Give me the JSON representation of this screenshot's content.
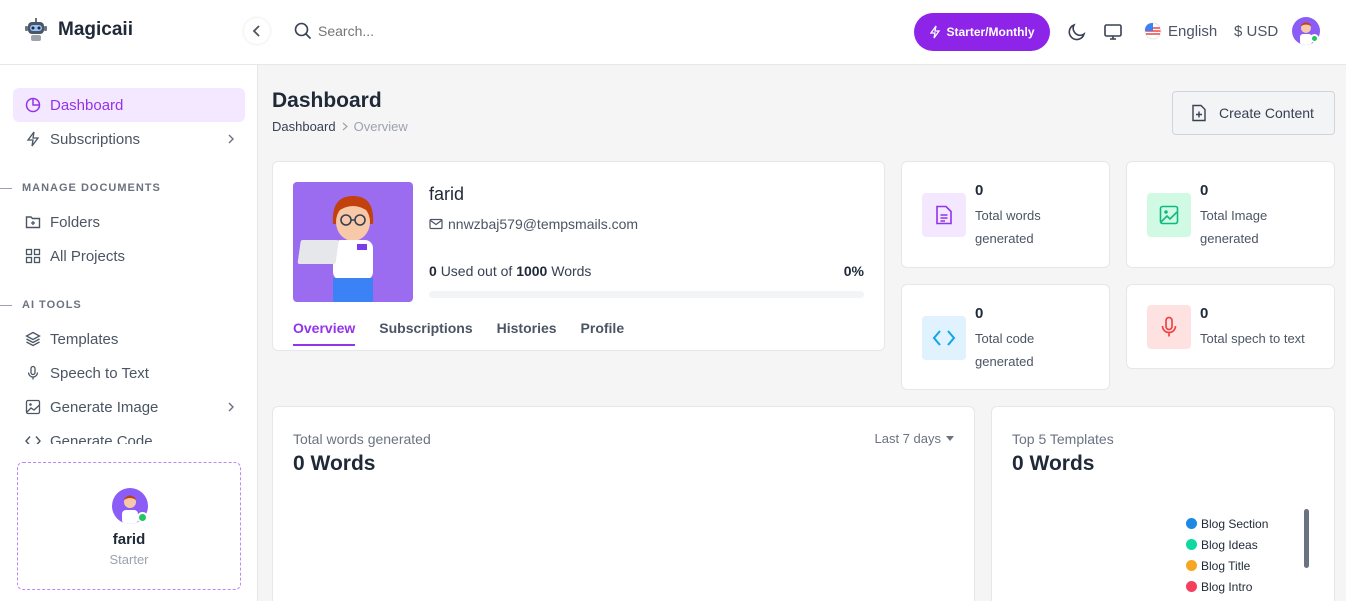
{
  "app": {
    "name": "Magicaii"
  },
  "header": {
    "search_placeholder": "Search...",
    "plan_label": "Starter/Monthly",
    "language": "English",
    "currency": "$ USD"
  },
  "sidebar": {
    "items": [
      {
        "label": "Dashboard"
      },
      {
        "label": "Subscriptions"
      },
      {
        "label": "Folders"
      },
      {
        "label": "All Projects"
      },
      {
        "label": "Templates"
      },
      {
        "label": "Speech to Text"
      },
      {
        "label": "Generate Image"
      },
      {
        "label": "Generate Code"
      }
    ],
    "sections": [
      "MANAGE DOCUMENTS",
      "AI TOOLS"
    ],
    "user": {
      "name": "farid",
      "role": "Starter"
    }
  },
  "page": {
    "title": "Dashboard",
    "breadcrumb": [
      "Dashboard",
      "Overview"
    ],
    "create_label": "Create Content"
  },
  "profile": {
    "name": "farid",
    "email": "nnwzbaj579@tempsmails.com",
    "used": "0",
    "used_text": "Used out of",
    "total": "1000",
    "unit": "Words",
    "percent": "0%",
    "progress_fraction": 0,
    "tabs": [
      "Overview",
      "Subscriptions",
      "Histories",
      "Profile"
    ]
  },
  "stats": [
    {
      "value": "0",
      "label": "Total words generated",
      "icon": "document-icon",
      "color": "#9333ea"
    },
    {
      "value": "0",
      "label": "Total Image generated",
      "icon": "image-icon",
      "color": "#10b981"
    },
    {
      "value": "0",
      "label": "Total code generated",
      "icon": "code-icon",
      "color": "#0ea5e9"
    },
    {
      "value": "0",
      "label": "Total spech to text",
      "icon": "microphone-icon",
      "color": "#ef4444"
    }
  ],
  "words_chart": {
    "label": "Total words generated",
    "value": "0 Words",
    "range": "Last 7 days"
  },
  "templates_chart": {
    "label": "Top 5 Templates",
    "value": "0 Words",
    "legend": [
      {
        "name": "Blog Section",
        "color": "#1e88e5"
      },
      {
        "name": "Blog Ideas",
        "color": "#10d9a0"
      },
      {
        "name": "Blog Title",
        "color": "#f5a623"
      },
      {
        "name": "Blog Intro",
        "color": "#f43f5e"
      }
    ]
  },
  "colors": {
    "accent": "#9333ea",
    "online": "#22c55e"
  }
}
